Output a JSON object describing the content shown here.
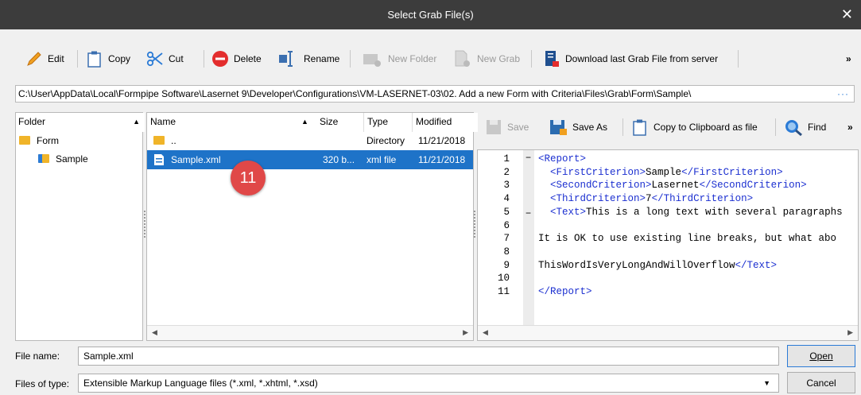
{
  "window": {
    "title": "Select Grab File(s)",
    "close_glyph": "✕"
  },
  "toolbar": {
    "edit": "Edit",
    "copy": "Copy",
    "cut": "Cut",
    "delete": "Delete",
    "rename": "Rename",
    "new_folder": "New Folder",
    "new_grab": "New Grab",
    "download": "Download last Grab File from server",
    "overflow": "»"
  },
  "path": {
    "value": "C:\\User\\AppData\\Local\\Formpipe Software\\Lasernet 9\\Developer\\Configurations\\VM-LASERNET-03\\02. Add a new Form with Criteria\\Files\\Grab\\Form\\Sample\\",
    "more": "···"
  },
  "folders": {
    "header": "Folder",
    "items": [
      {
        "label": "Form"
      },
      {
        "label": "Sample"
      }
    ]
  },
  "files": {
    "columns": {
      "name": "Name",
      "size": "Size",
      "type": "Type",
      "modified": "Modified"
    },
    "rows": [
      {
        "name": "..",
        "size": "",
        "type": "Directory",
        "modified": "11/21/2018"
      },
      {
        "name": "Sample.xml",
        "size": "320 b...",
        "type": "xml file",
        "modified": "11/21/2018"
      }
    ],
    "badge": "11"
  },
  "editor_toolbar": {
    "save": "Save",
    "save_as": "Save As",
    "copy_clipboard": "Copy to Clipboard as file",
    "find": "Find",
    "overflow": "»"
  },
  "editor": {
    "line_numbers": [
      "1",
      "2",
      "3",
      "4",
      "5",
      "6",
      "7",
      "8",
      "9",
      "10",
      "11"
    ],
    "lines": [
      {
        "pre": "",
        "tag": "<Report>",
        "text": "",
        "end": ""
      },
      {
        "pre": "  ",
        "tag": "<FirstCriterion>",
        "text": "Sample",
        "end": "</FirstCriterion>"
      },
      {
        "pre": "  ",
        "tag": "<SecondCriterion>",
        "text": "Lasernet",
        "end": "</SecondCriterion>"
      },
      {
        "pre": "  ",
        "tag": "<ThirdCriterion>",
        "text": "7",
        "end": "</ThirdCriterion>"
      },
      {
        "pre": "  ",
        "tag": "<Text>",
        "text": "This is a long text with several paragraphs",
        "end": ""
      },
      {
        "pre": "",
        "tag": "",
        "text": "",
        "end": ""
      },
      {
        "pre": "",
        "tag": "",
        "text": "It is OK to use existing line breaks, but what abo",
        "end": ""
      },
      {
        "pre": "",
        "tag": "",
        "text": "",
        "end": ""
      },
      {
        "pre": "",
        "tag": "",
        "text": "ThisWordIsVeryLongAndWillOverflow",
        "end": "</Text>"
      },
      {
        "pre": "",
        "tag": "",
        "text": "",
        "end": ""
      },
      {
        "pre": "",
        "tag": "</Report>",
        "text": "",
        "end": ""
      }
    ]
  },
  "bottom": {
    "file_name_label": "File name:",
    "file_name_value": "Sample.xml",
    "files_of_type_label": "Files of type:",
    "files_of_type_value": "Extensible Markup Language files (*.xml, *.xhtml, *.xsd)",
    "open": "Open",
    "cancel": "Cancel"
  }
}
